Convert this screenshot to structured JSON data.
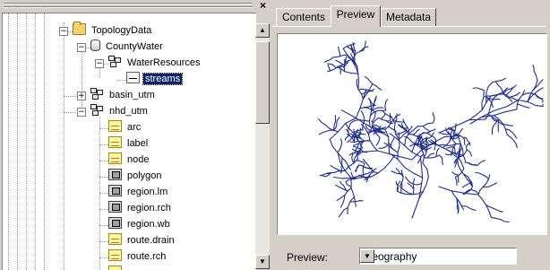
{
  "catalog_tree": {
    "nodes": [
      {
        "label": "TopologyData",
        "icon": "folder-icon",
        "expander": "−"
      },
      {
        "label": "CountyWater",
        "icon": "database-icon",
        "expander": "−"
      },
      {
        "label": "WaterResources",
        "icon": "feature-dataset-icon",
        "expander": "−"
      },
      {
        "label": "streams",
        "icon": "line-feature-class-icon",
        "selected": true
      },
      {
        "label": "basin_utm",
        "icon": "coverage-icon",
        "expander": "+"
      },
      {
        "label": "nhd_utm",
        "icon": "coverage-icon",
        "expander": "−"
      },
      {
        "label": "arc",
        "icon": "arc-icon"
      },
      {
        "label": "label",
        "icon": "label-icon"
      },
      {
        "label": "node",
        "icon": "node-icon"
      },
      {
        "label": "polygon",
        "icon": "polygon-icon"
      },
      {
        "label": "region.lm",
        "icon": "region-icon"
      },
      {
        "label": "region.rch",
        "icon": "region-icon"
      },
      {
        "label": "region.wb",
        "icon": "region-icon"
      },
      {
        "label": "route.drain",
        "icon": "route-icon"
      },
      {
        "label": "route.rch",
        "icon": "route-icon"
      }
    ]
  },
  "tabs": [
    {
      "label": "Contents",
      "active": false
    },
    {
      "label": "Preview",
      "active": true
    },
    {
      "label": "Metadata",
      "active": false
    }
  ],
  "preview": {
    "label": "Preview:",
    "selected_option": "Geography",
    "line_color": "#1f2d8f"
  }
}
